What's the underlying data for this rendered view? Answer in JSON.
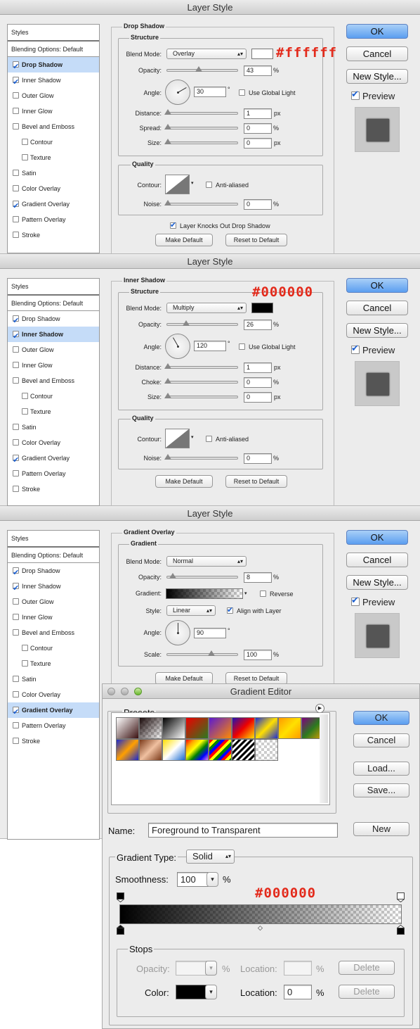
{
  "dialog_title": "Layer Style",
  "style_list": {
    "header": "Styles",
    "blending": "Blending Options: Default",
    "items": [
      "Drop Shadow",
      "Inner Shadow",
      "Outer Glow",
      "Inner Glow",
      "Bevel and Emboss",
      "Contour",
      "Texture",
      "Satin",
      "Color Overlay",
      "Gradient Overlay",
      "Pattern Overlay",
      "Stroke"
    ]
  },
  "buttons": {
    "ok": "OK",
    "cancel": "Cancel",
    "new_style": "New Style...",
    "preview": "Preview"
  },
  "panel1": {
    "section": "Drop Shadow",
    "structure": "Structure",
    "blend_mode_label": "Blend Mode:",
    "blend_mode": "Overlay",
    "color": "#ffffff",
    "opacity_label": "Opacity:",
    "opacity": "43",
    "opacity_fraction": 0.43,
    "angle_label": "Angle:",
    "angle": "30",
    "global_light": "Use Global Light",
    "distance_label": "Distance:",
    "distance": "1",
    "spread_label": "Spread:",
    "spread": "0",
    "size_label": "Size:",
    "size": "0",
    "quality": "Quality",
    "contour_label": "Contour:",
    "anti_aliased": "Anti-aliased",
    "noise_label": "Noise:",
    "noise": "0",
    "knocks_out": "Layer Knocks Out Drop Shadow",
    "make_default": "Make Default",
    "reset_default": "Reset to Default",
    "annotation": "#ffffff"
  },
  "panel2": {
    "section": "Inner Shadow",
    "structure": "Structure",
    "blend_mode_label": "Blend Mode:",
    "blend_mode": "Multiply",
    "color": "#000000",
    "opacity_label": "Opacity:",
    "opacity": "26",
    "opacity_fraction": 0.26,
    "angle_label": "Angle:",
    "angle": "120",
    "global_light": "Use Global Light",
    "distance_label": "Distance:",
    "distance": "1",
    "choke_label": "Choke:",
    "choke": "0",
    "size_label": "Size:",
    "size": "0",
    "quality": "Quality",
    "contour_label": "Contour:",
    "anti_aliased": "Anti-aliased",
    "noise_label": "Noise:",
    "noise": "0",
    "make_default": "Make Default",
    "reset_default": "Reset to Default",
    "annotation": "#000000"
  },
  "panel3": {
    "section": "Gradient Overlay",
    "gradient_group": "Gradient",
    "blend_mode_label": "Blend Mode:",
    "blend_mode": "Normal",
    "opacity_label": "Opacity:",
    "opacity": "8",
    "opacity_fraction": 0.08,
    "gradient_label": "Gradient:",
    "reverse": "Reverse",
    "style_label": "Style:",
    "style": "Linear",
    "align": "Align with Layer",
    "angle_label": "Angle:",
    "angle": "90",
    "scale_label": "Scale:",
    "scale": "100",
    "scale_fraction": 0.5,
    "make_default": "Make Default",
    "reset_default": "Reset to Default"
  },
  "gradient_editor": {
    "title": "Gradient Editor",
    "presets": "Presets",
    "ok": "OK",
    "cancel": "Cancel",
    "load": "Load...",
    "save": "Save...",
    "new": "New",
    "name_label": "Name:",
    "name": "Foreground to Transparent",
    "type_label": "Gradient Type:",
    "type": "Solid",
    "smoothness_label": "Smoothness:",
    "smoothness": "100",
    "percent": "%",
    "annotation": "#000000",
    "stops": "Stops",
    "opacity_label": "Opacity:",
    "location_label": "Location:",
    "color_label": "Color:",
    "color_location": "0",
    "delete": "Delete"
  }
}
